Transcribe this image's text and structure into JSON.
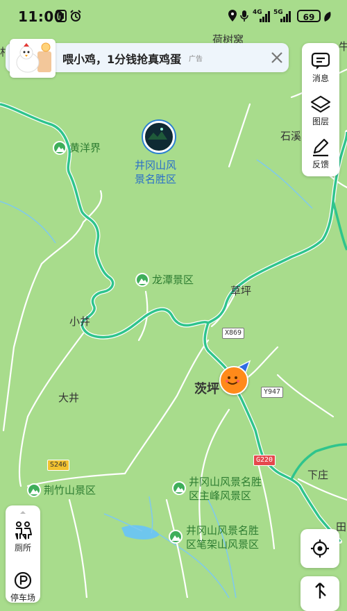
{
  "status_bar": {
    "time": "11:00",
    "network_labels": [
      "4G",
      "5G"
    ],
    "battery": "69"
  },
  "ad_banner": {
    "text": "喂小鸡，1分钱抢真鸡蛋",
    "tag": "广告"
  },
  "right_toolbar": {
    "items": [
      {
        "label": "消息",
        "icon": "message-icon"
      },
      {
        "label": "图层",
        "icon": "layers-icon"
      },
      {
        "label": "反馈",
        "icon": "feedback-icon"
      }
    ]
  },
  "left_toolbar": {
    "items": [
      {
        "label": "厕所",
        "icon": "toilet-icon"
      },
      {
        "label": "停车场",
        "icon": "parking-icon"
      }
    ]
  },
  "map": {
    "scenic": {
      "name_line1": "井冈山风",
      "name_line2": "景名胜区"
    },
    "places": {
      "hechuowo": "荷树窝",
      "shixi": "石溪",
      "caoping": "草坪",
      "xiaojing": "小井",
      "dajing": "大井",
      "ciping": "茨坪",
      "xiazhuang": "下庄",
      "edge_top_left": "村",
      "edge_top_right": "牛",
      "edge_mid_right": "田"
    },
    "pois": {
      "huangyangjie": "黄洋界",
      "longtan": "龙潭景区",
      "jingzhushan": "荆竹山景区",
      "zhufeng_1": "井冈山风景名胜",
      "zhufeng_2": "区主峰风景区",
      "bijiashan_1": "井冈山风景名胜",
      "bijiashan_2": "区笔架山风景区"
    },
    "road_shields": {
      "x869": "X869",
      "y947": "Y947",
      "s246": "S246",
      "g220": "G220"
    }
  },
  "colors": {
    "land": "#a8dc8c",
    "road_highlight": "#2fc48d",
    "water": "#6ec6ee",
    "poi_green": "#3fae5a"
  }
}
